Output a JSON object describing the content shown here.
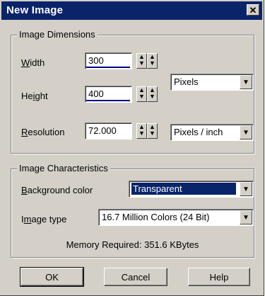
{
  "dialog": {
    "title": "New Image",
    "close_glyph": "✕"
  },
  "dimensions": {
    "legend": "Image Dimensions",
    "width": {
      "label_first": "W",
      "label_rest": "idth",
      "value": "300"
    },
    "height": {
      "label_pre": "He",
      "label_ul": "i",
      "label_post": "ght",
      "value": "400"
    },
    "resolution": {
      "label_first": "R",
      "label_rest": "esolution",
      "value": "72.000"
    },
    "size_unit": "Pixels",
    "resolution_unit": "Pixels / inch"
  },
  "characteristics": {
    "legend": "Image Characteristics",
    "background": {
      "label_first": "B",
      "label_rest": "ackground color",
      "value": "Transparent"
    },
    "image_type": {
      "label_pre": "I",
      "label_ul": "m",
      "label_post": "age type",
      "value": "16.7 Million Colors (24 Bit)"
    },
    "memory": "Memory Required: 351.6 KBytes"
  },
  "buttons": {
    "ok": "OK",
    "cancel": "Cancel",
    "help": "Help"
  },
  "icons": {
    "spin_up": "arrow-up-icon",
    "spin_down": "arrow-down-icon",
    "dropdown": "chevron-down-icon"
  },
  "colors": {
    "titlebar": "#0a246a",
    "face": "#d4d0c8",
    "selection": "#0a246a"
  }
}
